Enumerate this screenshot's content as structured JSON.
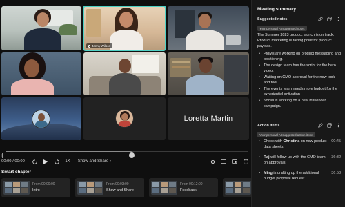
{
  "video": {
    "participants": {
      "jenny_name": "Jenny Wilson",
      "loretta_name": "Loretta Martin"
    },
    "time_display": "00:00 / 00:00",
    "speed_label": "1X",
    "show_share_label": "Show and Share",
    "progress": 0.52
  },
  "smart_chapter": {
    "title": "Smart chapter",
    "chapters": [
      {
        "from": "From 00:00:00",
        "label": "Intro"
      },
      {
        "from": "From 00:03:00",
        "label": "Show and Share"
      },
      {
        "from": "From 00:12:00",
        "label": "Feedback"
      }
    ]
  },
  "summary_panel": {
    "title": "Meeting summary",
    "suggested_notes_title": "Suggested notes",
    "notes_badge": "Your personal AI suggested notes",
    "summary_text": "The Summer 2023 product launch is on track. Product marketing is taking point for product payload.",
    "bullets": [
      "PMMs are working on product messaging and positioning.",
      "The design team has the script for the hero video.",
      "Waiting on CMO approval for the new look and feel",
      "The events team needs more budget for the experiential activation.",
      "Social is working on a new influencer campaign."
    ],
    "action_items_title": "Action items",
    "actions_badge": "Your personal AI suggested action items",
    "actions": [
      {
        "pre": "Check with ",
        "name": "Christina",
        "post": " on new product data sheets.",
        "time": "00:45"
      },
      {
        "pre": "",
        "name": "Raj",
        "post": " will follow up with the CMO team on approvals.",
        "time": "36:32"
      },
      {
        "pre": "",
        "name": "Ming",
        "post": " is drafting up the additional budget proposal request.",
        "time": "36:58"
      }
    ]
  },
  "colors": {
    "accent": "#4fd1c5",
    "panel_bg": "#181818",
    "stage_bg": "#0f0f0f"
  }
}
